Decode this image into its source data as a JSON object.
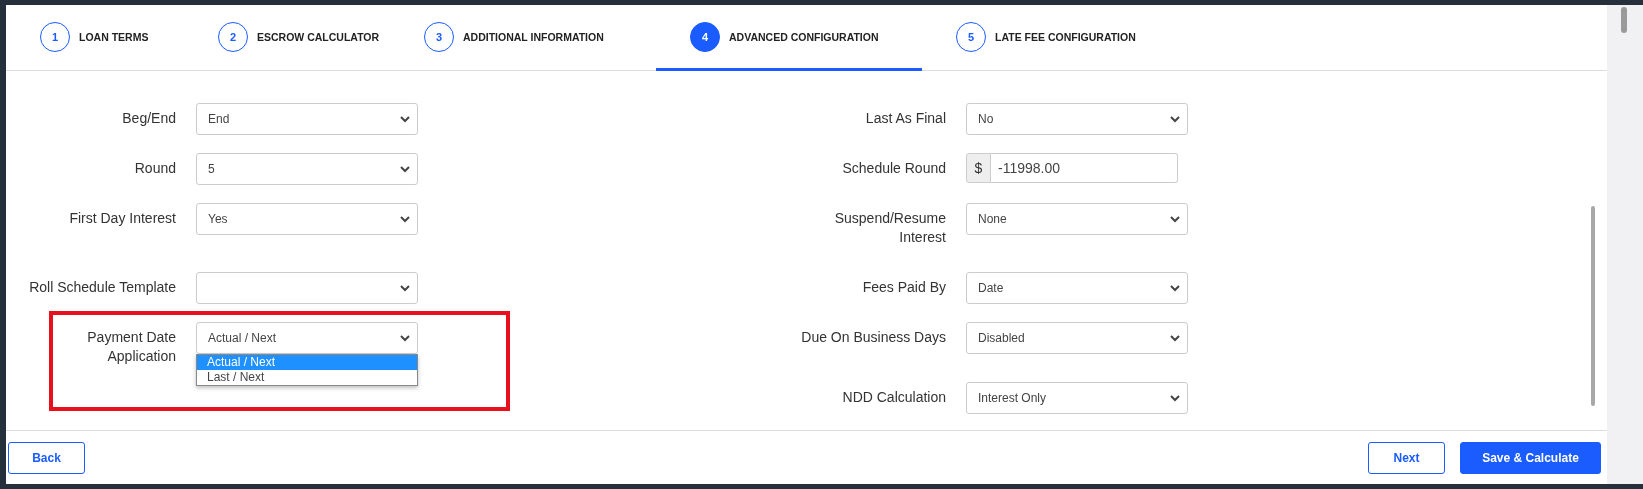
{
  "steps": [
    {
      "number": "1",
      "label": "LOAN TERMS",
      "selected": false
    },
    {
      "number": "2",
      "label": "ESCROW CALCULATOR",
      "selected": false
    },
    {
      "number": "3",
      "label": "ADDITIONAL INFORMATION",
      "selected": false
    },
    {
      "number": "4",
      "label": "ADVANCED CONFIGURATION",
      "selected": true
    },
    {
      "number": "5",
      "label": "LATE FEE CONFIGURATION",
      "selected": false
    }
  ],
  "form_rows": [
    {
      "left": {
        "kind": "select",
        "label": "Beg/End",
        "value": "End"
      },
      "right": {
        "kind": "select",
        "label": "Last As Final",
        "value": "No"
      }
    },
    {
      "left": {
        "kind": "select",
        "label": "Round",
        "value": "5"
      },
      "right": {
        "kind": "currency",
        "label": "Schedule Round",
        "prefix": "$",
        "value": "-11998.00"
      }
    },
    {
      "left": {
        "kind": "select",
        "label": "First Day Interest",
        "value": "Yes"
      },
      "right": {
        "kind": "select",
        "label": "Suspend/Resume Interest",
        "value": "None"
      }
    },
    {
      "left": {
        "kind": "select",
        "label": "Roll Schedule Template"
      },
      "right": {
        "kind": "select",
        "label": "Fees Paid By",
        "value": "Date"
      }
    },
    {
      "left": {
        "kind": "select",
        "label": "Payment Date Application",
        "value": "Actual / Next",
        "highlighted": true,
        "options": [
          {
            "label": "Actual / Next",
            "selected": true
          },
          {
            "label": "Last / Next",
            "selected": false
          }
        ]
      },
      "right": {
        "kind": "select",
        "label": "Due On Business Days",
        "value": "Disabled"
      }
    },
    {
      "right": {
        "kind": "select",
        "label": "NDD Calculation",
        "value": "Interest Only"
      }
    }
  ],
  "footer": {
    "back": "Back",
    "next": "Next",
    "save": "Save & Calculate"
  }
}
